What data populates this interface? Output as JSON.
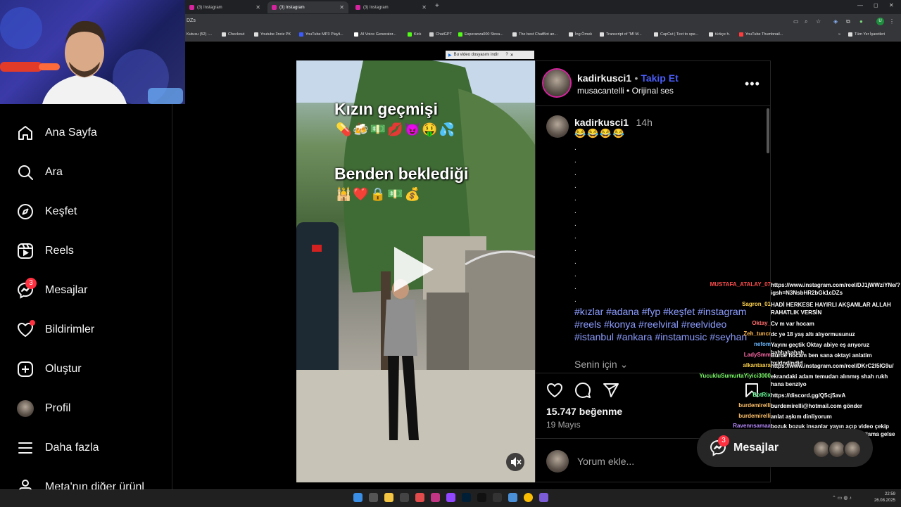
{
  "browser": {
    "tabs": [
      {
        "label": "(3) Instagram",
        "active": false
      },
      {
        "label": "(3) Instagram",
        "active": true
      },
      {
        "label": "(3) Instagram",
        "active": false
      }
    ],
    "url_fragment": "DZs",
    "bookmarks": [
      "Kutusu (52) -...",
      "Checkout",
      "Youtube 3nciz PK",
      "YouTube MP3 Playli...",
      "AI Voice Generator...",
      "Kick",
      "ChatGPT",
      "Esperanza000 Strea...",
      "The best ChatBot an...",
      "İng Örnek",
      "Transcript of \"Mİ M...",
      "CapCut | Text to spe...",
      "türkçe h.",
      "YouTube Thumbnail...",
      "Tüm Yer İşaretleri"
    ],
    "profile_initial": "U",
    "download_bar": "Bu video dosyasını indir"
  },
  "sidebar": {
    "items": [
      {
        "label": "Ana Sayfa",
        "icon": "home-icon"
      },
      {
        "label": "Ara",
        "icon": "search-icon"
      },
      {
        "label": "Keşfet",
        "icon": "compass-icon"
      },
      {
        "label": "Reels",
        "icon": "reels-icon"
      },
      {
        "label": "Mesajlar",
        "icon": "messenger-icon",
        "badge": "3"
      },
      {
        "label": "Bildirimler",
        "icon": "heart-icon",
        "dot": true
      },
      {
        "label": "Oluştur",
        "icon": "plus-square-icon"
      },
      {
        "label": "Profil",
        "icon": "profile-avatar-icon"
      },
      {
        "label": "Daha fazla",
        "icon": "menu-icon"
      },
      {
        "label": "Meta'nın diğer ürünl",
        "icon": "meta-apps-icon"
      }
    ]
  },
  "video": {
    "line1": "Kızın geçmişi",
    "emoji1": "💊🍻💵💋😈🤑💦",
    "line2": "Benden beklediği",
    "emoji2": "🕌❤️🔒💵💰"
  },
  "post": {
    "author": "kadirkusci1",
    "follow_label": "Takip Et",
    "audio_owner": "musacantelli",
    "audio_label": "Orijinal ses",
    "comment_user": "kadirkusci1",
    "comment_time": "14h",
    "comment_emoji": "😂😂😂😂",
    "hashtags": "#kızlar #adana #fyp #keşfet #instagram #reels #konya #reelviral #reelvideo #istanbul #ankara #instamusic #seyhan",
    "translate_label": "Senin için",
    "likes": "15.747 beğenme",
    "date": "19 Mayıs",
    "comment_placeholder": "Yorum ekle..."
  },
  "chat": [
    {
      "name": "MUSTAFA_ATALAY_07",
      "color": "#ff4d4d",
      "msg": "https://www.instagram.com/reel/DJ1jWWziYNe/?igsh=N3NsbHR2bGk1cDZs"
    },
    {
      "name": "Sagron_01",
      "color": "#ffd24d",
      "msg": "HADİ HERKESE HAYIRLI AKŞAMLAR ALLAH RAHATLIK VERSİN"
    },
    {
      "name": "Oktay_",
      "color": "#ff6b6b",
      "msg": "Cv m var hocam"
    },
    {
      "name": "Zeh_tuncr",
      "color": "#ffb84d",
      "msg": "dc ye 18 yaş altı alıyormusunuz"
    },
    {
      "name": "nefom",
      "color": "#6bb8ff",
      "msg": "Yayını geçtik Oktay abiye eş arıyoruz hahhahahah"
    },
    {
      "name": "LadySmm",
      "color": "#ff6ba8",
      "msg": "Burde hocam ben sana oktayi anlatim bxidndindjd"
    },
    {
      "name": "alkantaara",
      "color": "#ffd24d",
      "msg": "https://www.instagram.com/reel/DKrC2I5IG9u/"
    },
    {
      "name": "YucukluSumurtaYiyici3000",
      "color": "#7dff6b",
      "msg": "ekrandaki adam temudan alınmış shah rukh hana benziyo"
    },
    {
      "name": "BotRix",
      "color": "#6bff9c",
      "msg": "https://discord.gg/Q5cj5avA"
    },
    {
      "name": "burdemirelli",
      "color": "#ffc16b",
      "msg": "burdemirelli@hotmail.com gönder"
    },
    {
      "name": "burdemirelli",
      "color": "#ffc16b",
      "msg": "anlat aşkım dinliyorum"
    },
    {
      "name": "Ravennsamaa",
      "color": "#b98cff",
      "msg": "bozuk bozuk insanlar yayın açıp video çekip çoluk çocuğu zehirliyo bunlara kısıtlama gelse keşke"
    }
  ],
  "messages_pill": {
    "label": "Mesajlar",
    "badge": "3"
  },
  "taskbar": {
    "time": "22:59",
    "date": "26.08.2025"
  }
}
